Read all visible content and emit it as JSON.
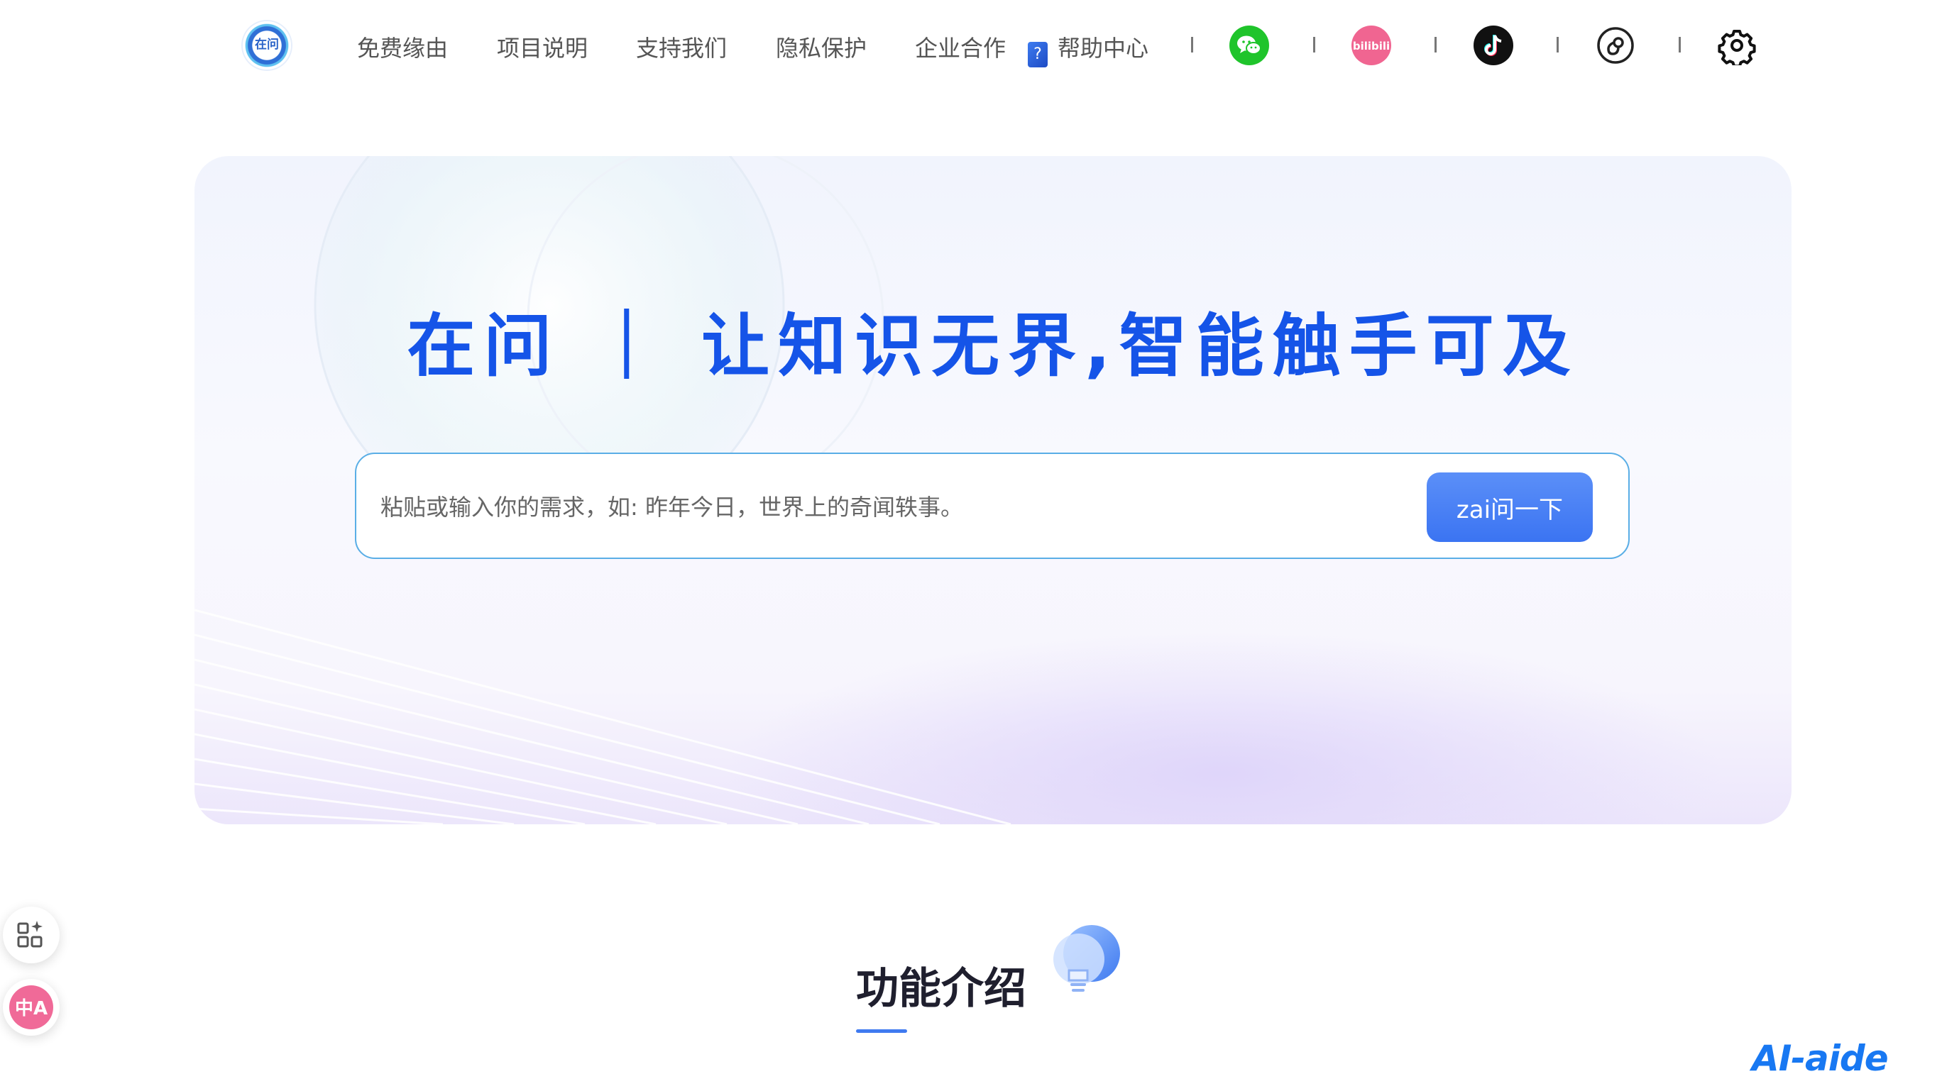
{
  "header": {
    "logo_text": "在问",
    "nav": [
      {
        "label": "免费缘由"
      },
      {
        "label": "项目说明"
      },
      {
        "label": "支持我们"
      },
      {
        "label": "隐私保护"
      },
      {
        "label": "企业合作"
      },
      {
        "label": "帮助中心",
        "icon": "help-book-icon"
      }
    ],
    "social": [
      {
        "icon": "wechat-icon",
        "color": "#1fc42b"
      },
      {
        "icon": "bilibili-icon",
        "color": "#f06591",
        "text": "bilibili"
      },
      {
        "icon": "douyin-icon",
        "color": "#111111"
      },
      {
        "icon": "link-circle-icon",
        "color": "#333333"
      },
      {
        "icon": "settings-gear-icon",
        "color": "#111111"
      }
    ]
  },
  "hero": {
    "title": "在问 ｜ 让知识无界,智能触手可及",
    "search": {
      "placeholder": "粘贴或输入你的需求，如: 昨年今日，世界上的奇闻轶事。",
      "value": "",
      "button_label": "zai问一下"
    }
  },
  "features": {
    "title": "功能介绍",
    "icon": "lightbulb-chat-icon"
  },
  "floating": [
    {
      "icon": "apps-sparkle-icon"
    },
    {
      "icon": "translate-icon",
      "text": "中A"
    }
  ],
  "watermark": "AI-aide",
  "colors": {
    "accent": "#1554e8",
    "button": "#3b74f2",
    "search_border": "#5aaee6",
    "wechat": "#1fc42b",
    "bilibili": "#f06591"
  }
}
